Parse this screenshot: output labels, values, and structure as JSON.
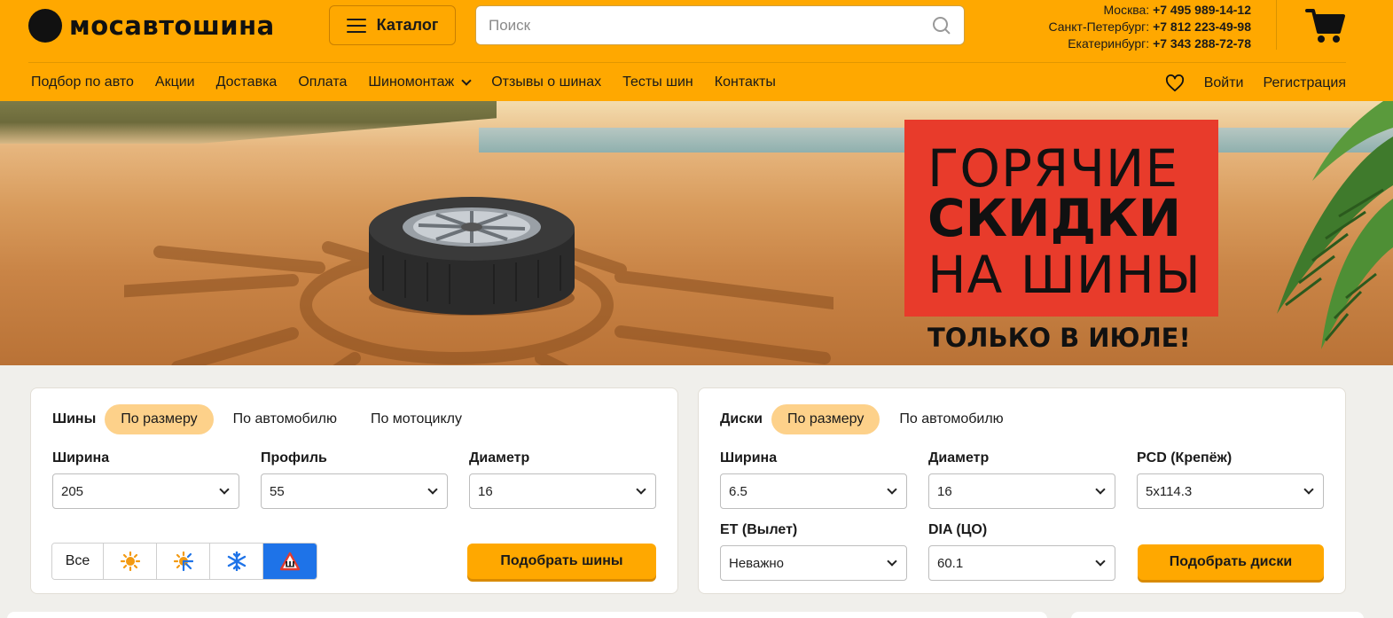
{
  "header": {
    "logo_text": "мосавтошина",
    "catalog_label": "Каталог",
    "search_placeholder": "Поиск",
    "phones": [
      {
        "city": "Москва:",
        "number": "+7 495 989-14-12"
      },
      {
        "city": "Санкт-Петербург:",
        "number": "+7 812 223-49-98"
      },
      {
        "city": "Екатеринбург:",
        "number": "+7 343 288-72-78"
      }
    ],
    "accent_color": "#ffa800"
  },
  "nav": {
    "items": [
      "Подбор по авто",
      "Акции",
      "Доставка",
      "Оплата",
      "Шиномонтаж",
      "Отзывы о шинах",
      "Тесты шин",
      "Контакты"
    ],
    "login": "Войти",
    "register": "Регистрация"
  },
  "banner": {
    "line1": "ГОРЯЧИЕ",
    "line2": "СКИДКИ",
    "line3": "НА ШИНЫ",
    "line4": "ТОЛЬКО В ИЮЛЕ!",
    "promo_color": "#e83b2b"
  },
  "tires": {
    "title": "Шины",
    "tabs": [
      "По размеру",
      "По автомобилю",
      "По мотоциклу"
    ],
    "width_label": "Ширина",
    "width_value": "205",
    "profile_label": "Профиль",
    "profile_value": "55",
    "diameter_label": "Диаметр",
    "diameter_value": "16",
    "season_all": "Все",
    "season_icons": [
      "sun-icon",
      "sun-snow-icon",
      "snowflake-icon",
      "spikes-icon"
    ],
    "button": "Подобрать шины"
  },
  "disks": {
    "title": "Диски",
    "tabs": [
      "По размеру",
      "По автомобилю"
    ],
    "width_label": "Ширина",
    "width_value": "6.5",
    "diameter_label": "Диаметр",
    "diameter_value": "16",
    "pcd_label": "PCD (Крепёж)",
    "pcd_value": "5x114.3",
    "et_label": "ET (Вылет)",
    "et_value": "Неважно",
    "dia_label": "DIA (ЦО)",
    "dia_value": "60.1",
    "button": "Подобрать диски"
  }
}
